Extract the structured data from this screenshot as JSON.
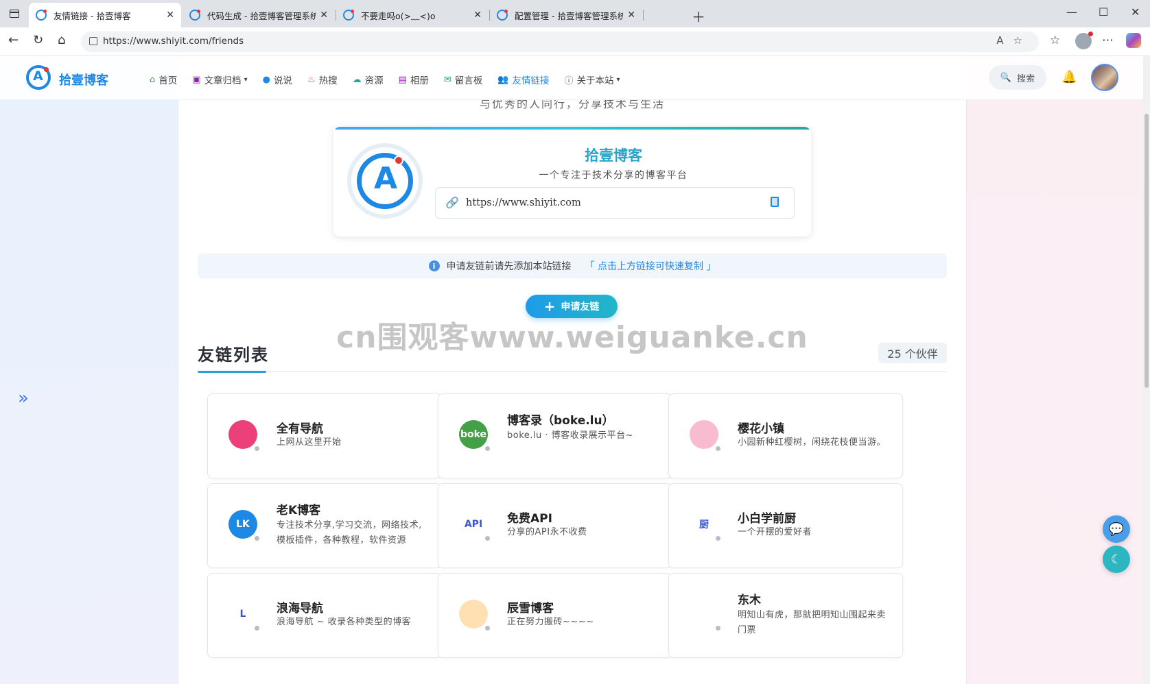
{
  "browser": {
    "tabs": [
      {
        "title": "友情链接 - 拾壹博客",
        "active": true
      },
      {
        "title": "代码生成 - 拾壹博客管理系统",
        "active": false
      },
      {
        "title": "不要走吗o(>﹏<)o",
        "active": false
      },
      {
        "title": "配置管理 - 拾壹博客管理系统",
        "active": false
      }
    ],
    "url": "https://www.shiyit.com/friends"
  },
  "header": {
    "site_name": "拾壹博客",
    "menu": [
      {
        "label": "首页",
        "icon": "home-icon",
        "color": "#43a047"
      },
      {
        "label": "文章归档",
        "icon": "archive-icon",
        "color": "#8e24aa",
        "dropdown": true
      },
      {
        "label": "说说",
        "icon": "chat-icon",
        "color": "#1e88e5"
      },
      {
        "label": "热搜",
        "icon": "fire-icon",
        "color": "#e53935"
      },
      {
        "label": "资源",
        "icon": "cloud-download-icon",
        "color": "#26a69a"
      },
      {
        "label": "相册",
        "icon": "image-icon",
        "color": "#8e24aa"
      },
      {
        "label": "留言板",
        "icon": "mail-icon",
        "color": "#26a69a"
      },
      {
        "label": "友情链接",
        "icon": "users-icon",
        "color": "#1e88e5",
        "active": true
      },
      {
        "label": "关于本站",
        "icon": "info-icon",
        "color": "#6d4c41",
        "dropdown": true
      }
    ],
    "search_label": "搜索"
  },
  "main": {
    "tagline": "与优秀的人同行，分享技术与生活",
    "site_card": {
      "title": "拾壹博客",
      "subtitle": "一个专注于技术分享的博客平台",
      "url": "https://www.shiyit.com"
    },
    "notice": {
      "text": "申请友链前请先添加本站链接",
      "highlight": "「 点击上方链接可快速复制 」"
    },
    "apply_button": "申请友链",
    "watermark": "cn围观客www.weiguanke.cn",
    "section_title": "友链列表",
    "count": "25 个伙伴",
    "friends": [
      {
        "name": "全有导航",
        "desc": "上网从这里开始",
        "logo_color": "#ec407a",
        "logo_text": ""
      },
      {
        "name": "博客录（boke.lu）",
        "desc": "boke.lu · 博客收录展示平台~",
        "logo_color": "#43a047",
        "logo_text": "boke"
      },
      {
        "name": "樱花小镇",
        "desc": "小园新种红樱树，闲绕花枝便当游。",
        "logo_color": "#f8bbd0",
        "logo_text": ""
      },
      {
        "name": "老K博客",
        "desc": "专注技术分享,学习交流，网络技术,模板插件，各种教程，软件资源",
        "logo_color": "#1e88e5",
        "logo_text": "LK"
      },
      {
        "name": "免费API",
        "desc": "分享的API永不收费",
        "logo_color": "#ffffff",
        "logo_text": "API"
      },
      {
        "name": "小白学前厨",
        "desc": "一个开摆的爱好者",
        "logo_color": "#ffffff",
        "logo_text": "厨"
      },
      {
        "name": "浪海导航",
        "desc": "浪海导航 ~ 收录各种类型的博客",
        "logo_color": "#ffffff",
        "logo_text": "L"
      },
      {
        "name": "辰雪博客",
        "desc": "正在努力搬砖~~~~",
        "logo_color": "#ffe0b2",
        "logo_text": ""
      },
      {
        "name": "东木",
        "desc": "明知山有虎，那就把明知山围起来卖门票",
        "logo_color": "#ffffff",
        "logo_text": ""
      }
    ]
  }
}
